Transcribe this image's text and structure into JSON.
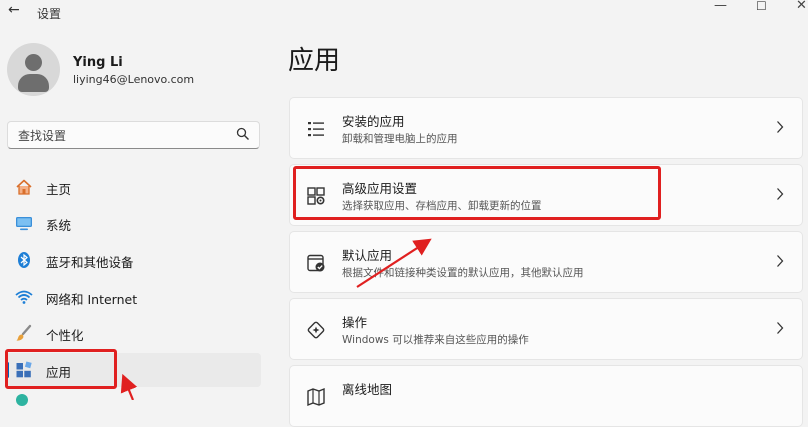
{
  "window": {
    "title": "设置",
    "back_glyph": "←",
    "minimize_glyph": "—",
    "maximize_glyph": "☐",
    "close_glyph": "✕"
  },
  "profile": {
    "name": "Ying Li",
    "email": "liying46@Lenovo.com"
  },
  "search": {
    "placeholder": "查找设置"
  },
  "sidebar": {
    "items": [
      {
        "label": "主页",
        "icon": "home-icon"
      },
      {
        "label": "系统",
        "icon": "system-icon"
      },
      {
        "label": "蓝牙和其他设备",
        "icon": "bluetooth-icon"
      },
      {
        "label": "网络和 Internet",
        "icon": "wifi-icon"
      },
      {
        "label": "个性化",
        "icon": "brush-icon"
      },
      {
        "label": "应用",
        "icon": "apps-icon",
        "selected": true
      }
    ]
  },
  "main": {
    "title": "应用",
    "cards": [
      {
        "title": "安装的应用",
        "desc": "卸载和管理电脑上的应用",
        "icon": "list-icon"
      },
      {
        "title": "高级应用设置",
        "desc": "选择获取应用、存档应用、卸载更新的位置",
        "icon": "app-settings-icon",
        "highlighted": true
      },
      {
        "title": "默认应用",
        "desc": "根据文件和链接种类设置的默认应用，其他默认应用",
        "icon": "default-apps-icon"
      },
      {
        "title": "操作",
        "desc": "Windows 可以推荐来自这些应用的操作",
        "icon": "actions-icon"
      },
      {
        "title": "离线地图",
        "desc": "",
        "icon": "map-icon"
      }
    ]
  },
  "colors": {
    "accent": "#005fb8",
    "annotation": "#e02020",
    "background": "#f3f3f3",
    "card": "#fbfbfb"
  }
}
